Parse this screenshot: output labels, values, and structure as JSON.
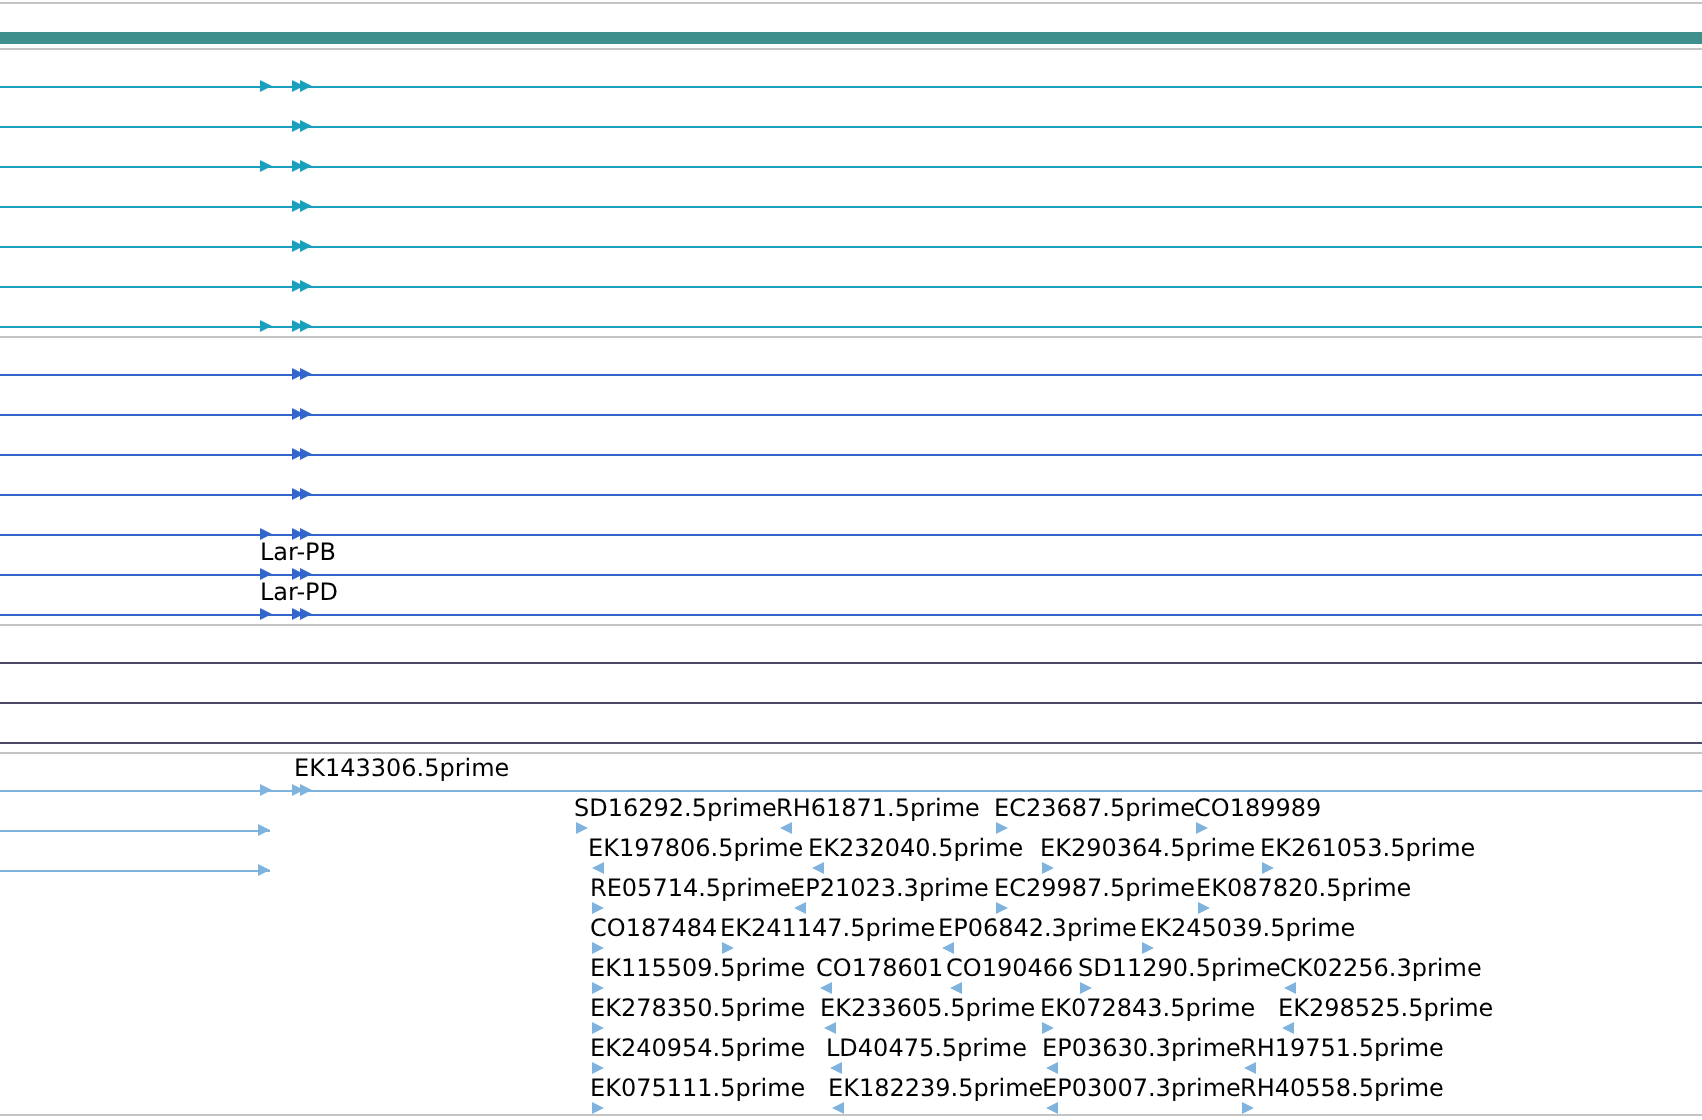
{
  "tracks": [
    {
      "kind": "scale_bar",
      "color": "#3f8f8f"
    },
    {
      "kind": "gene_models",
      "color": "#1a9fbf",
      "rows": [
        {
          "start_mark": true
        },
        {
          "start_mark": false
        },
        {
          "start_mark": true
        },
        {
          "start_mark": false
        },
        {
          "start_mark": false
        },
        {
          "start_mark": false
        },
        {
          "start_mark": true
        }
      ]
    },
    {
      "kind": "gene_models",
      "color": "#3366cc",
      "rows": [
        {
          "start_mark": false
        },
        {
          "start_mark": false
        },
        {
          "start_mark": false
        },
        {
          "start_mark": false
        },
        {
          "start_mark": true
        },
        {
          "start_mark": true,
          "label": "Lar-PB"
        },
        {
          "start_mark": true,
          "label": "Lar-PD"
        }
      ]
    },
    {
      "kind": "plain_lines",
      "color": "#4a4a66"
    },
    {
      "kind": "est_alignments",
      "color": "#7fb3dd",
      "label": "EK143306.5prime",
      "features": [
        [
          {
            "label": "SD16292.5prime",
            "reverse": false
          },
          {
            "label": "RH61871.5prime",
            "reverse": true
          },
          {
            "label": "EC23687.5prime",
            "reverse": false
          },
          {
            "label": "CO189989",
            "reverse": false
          }
        ],
        [
          {
            "label": "EK197806.5prime",
            "reverse": true
          },
          {
            "label": "EK232040.5prime",
            "reverse": true
          },
          {
            "label": "EK290364.5prime",
            "reverse": false
          },
          {
            "label": "EK261053.5prime",
            "reverse": false
          }
        ],
        [
          {
            "label": "RE05714.5prime",
            "reverse": false
          },
          {
            "label": "EP21023.3prime",
            "reverse": true
          },
          {
            "label": "EC29987.5prime",
            "reverse": false
          },
          {
            "label": "EK087820.5prime",
            "reverse": false
          }
        ],
        [
          {
            "label": "CO187484",
            "reverse": false
          },
          {
            "label": "EK241147.5prime",
            "reverse": false
          },
          {
            "label": "EP06842.3prime",
            "reverse": true
          },
          {
            "label": "EK245039.5prime",
            "reverse": false
          }
        ],
        [
          {
            "label": "EK115509.5prime",
            "reverse": false
          },
          {
            "label": "CO178601",
            "reverse": true
          },
          {
            "label": "CO190466",
            "reverse": true
          },
          {
            "label": "SD11290.5prime",
            "reverse": false
          },
          {
            "label": "CK02256.3prime",
            "reverse": true
          }
        ],
        [
          {
            "label": "EK278350.5prime",
            "reverse": false
          },
          {
            "label": "EK233605.5prime",
            "reverse": true
          },
          {
            "label": "EK072843.5prime",
            "reverse": false
          },
          {
            "label": "EK298525.5prime",
            "reverse": true
          }
        ],
        [
          {
            "label": "EK240954.5prime",
            "reverse": false
          },
          {
            "label": "LD40475.5prime",
            "reverse": true
          },
          {
            "label": "EP03630.3prime",
            "reverse": true
          },
          {
            "label": "RH19751.5prime",
            "reverse": true
          }
        ],
        [
          {
            "label": "EK075111.5prime",
            "reverse": false
          },
          {
            "label": "EK182239.5prime",
            "reverse": true
          },
          {
            "label": "EP03007.3prime",
            "reverse": true
          },
          {
            "label": "RH40558.5prime",
            "reverse": false
          }
        ]
      ]
    }
  ]
}
